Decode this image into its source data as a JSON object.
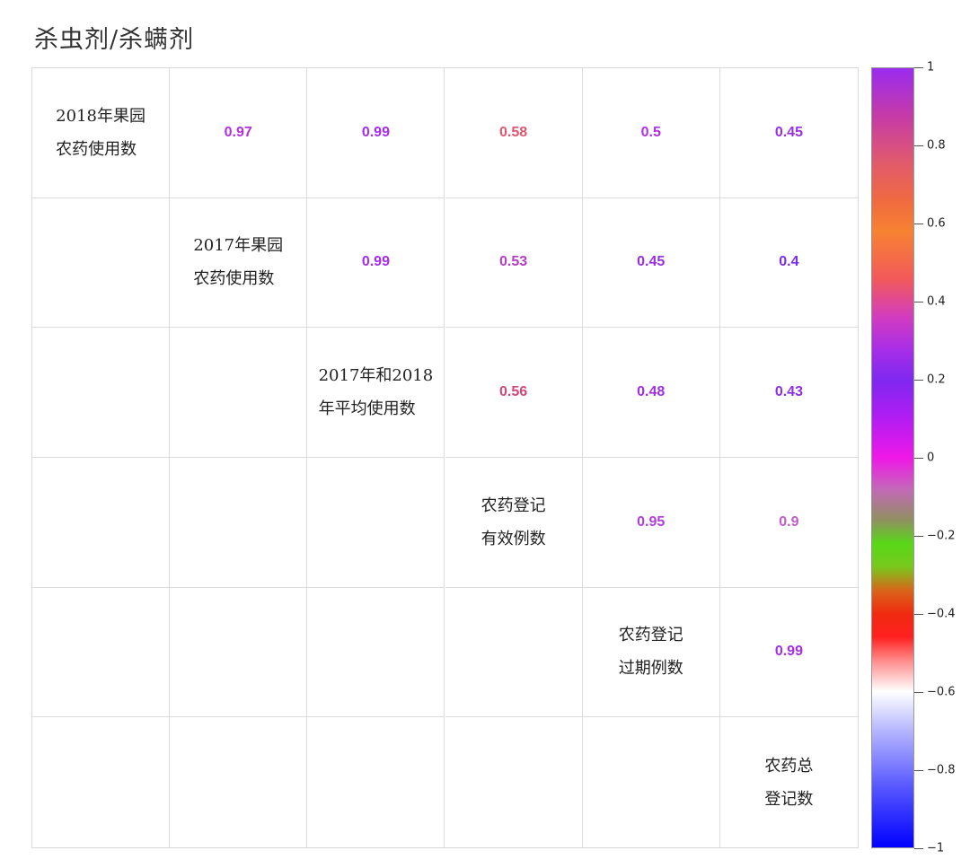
{
  "title": "杀虫剂/杀螨剂",
  "chart_data": {
    "type": "heatmap",
    "variables": [
      [
        "2018年果园",
        "农药使用数"
      ],
      [
        "2017年果园",
        "农药使用数"
      ],
      [
        "2017年和2018",
        "年平均使用数"
      ],
      [
        "农药登记",
        "有效例数"
      ],
      [
        "农药登记",
        "过期例数"
      ],
      [
        "农药总",
        "登记数"
      ]
    ],
    "upper_triangle": [
      [
        null,
        0.97,
        0.99,
        0.58,
        0.5,
        0.45
      ],
      [
        null,
        null,
        0.99,
        0.53,
        0.45,
        0.4
      ],
      [
        null,
        null,
        null,
        0.56,
        0.48,
        0.43
      ],
      [
        null,
        null,
        null,
        null,
        0.95,
        0.9
      ],
      [
        null,
        null,
        null,
        null,
        null,
        0.99
      ],
      [
        null,
        null,
        null,
        null,
        null,
        null
      ]
    ],
    "value_labels": [
      [
        null,
        "0.97",
        "0.99",
        "0.58",
        "0.5",
        "0.45"
      ],
      [
        null,
        null,
        "0.99",
        "0.53",
        "0.45",
        "0.4"
      ],
      [
        null,
        null,
        null,
        "0.56",
        "0.48",
        "0.43"
      ],
      [
        null,
        null,
        null,
        null,
        "0.95",
        "0.9"
      ],
      [
        null,
        null,
        null,
        null,
        null,
        "0.99"
      ],
      [
        null,
        null,
        null,
        null,
        null,
        null
      ]
    ],
    "colorbar": {
      "range": [
        -1,
        1
      ],
      "ticks": [
        "1",
        "0.8",
        "0.6",
        "0.4",
        "0.2",
        "0",
        "−0.2",
        "−0.4",
        "−0.6",
        "−0.8",
        "−1"
      ],
      "tick_values": [
        1,
        0.8,
        0.6,
        0.4,
        0.2,
        0,
        -0.2,
        -0.4,
        -0.6,
        -0.8,
        -1
      ]
    },
    "value_colors": {
      "0.97": "#b42ee2",
      "0.99": "#a52ee6",
      "0.58": "#e0566c",
      "0.5": "#b42ee6",
      "0.45": "#9a30e4",
      "0.53": "#b83cc8",
      "0.4": "#7a2cec",
      "0.56": "#d0487a",
      "0.48": "#a02ee4",
      "0.43": "#8e2ee6",
      "0.95": "#b03ee0",
      "0.9": "#c45ac8"
    }
  }
}
